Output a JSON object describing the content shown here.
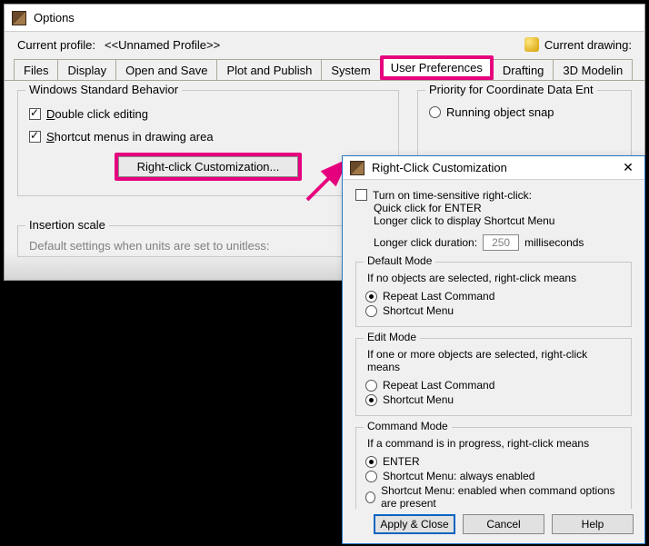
{
  "options_window": {
    "title": "Options",
    "profile_label": "Current profile:",
    "profile_value": "<<Unnamed Profile>>",
    "drawing_label": "Current drawing:",
    "tabs": [
      "Files",
      "Display",
      "Open and Save",
      "Plot and Publish",
      "System",
      "User Preferences",
      "Drafting",
      "3D Modelin"
    ],
    "highlighted_tab_index": 5,
    "wsb": {
      "legend": "Windows Standard Behavior",
      "double_click": {
        "label": "Double click editing",
        "underline": "D",
        "after": "ouble click editing",
        "checked": true
      },
      "shortcut_menus": {
        "label": "Shortcut menus in drawing area",
        "underline": "S",
        "after": "hortcut menus in drawing area",
        "checked": true
      },
      "rc_button": "Right-click Customization..."
    },
    "priority": {
      "legend": "Priority for Coordinate Data Ent",
      "running": {
        "underline": "R",
        "after": "unning object snap",
        "selected": false
      }
    },
    "insertion": {
      "legend": "Insertion scale",
      "text": "Default settings when units are set to unitless:"
    }
  },
  "dialog": {
    "title": "Right-Click Customization",
    "time_sensitive": {
      "label_pre": "T",
      "label_post": "urn on time-sensitive right-click:",
      "checked": false,
      "line1": "Quick click for ENTER",
      "line2": "Longer click to display Shortcut Menu",
      "dur_label": "Longer click duration:",
      "dur_value": "250",
      "dur_unit": "milliseconds"
    },
    "default_mode": {
      "legend": "Default Mode",
      "desc": "If no objects are selected, right-click means",
      "opt1": "Repeat Last Command",
      "opt2": "Shortcut Menu",
      "selected": 0
    },
    "edit_mode": {
      "legend": "Edit Mode",
      "desc": "If one or more objects are selected, right-click means",
      "opt1": "Repeat Last Command",
      "opt2": "Shortcut Menu",
      "selected": 1
    },
    "command_mode": {
      "legend": "Command Mode",
      "desc": "If a command is in progress, right-click means",
      "opt1": "ENTER",
      "opt2": "Shortcut Menu: always enabled",
      "opt3": "Shortcut Menu: enabled when command options are present",
      "selected": 0
    },
    "buttons": {
      "apply": "Apply & Close",
      "cancel": "Cancel",
      "help": "Help"
    }
  }
}
